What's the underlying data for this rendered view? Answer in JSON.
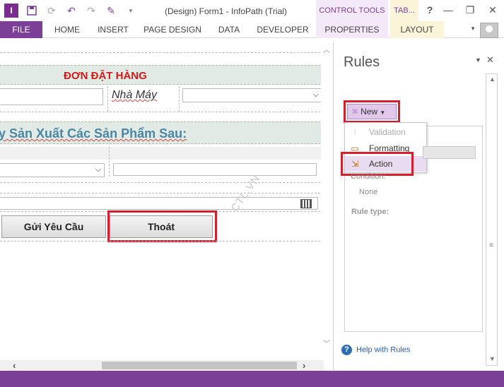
{
  "window": {
    "title": "(Design) Form1 - InfoPath (Trial)",
    "app_logo": "I",
    "contextual_groups": [
      "CONTROL TOOLS",
      "TAB..."
    ],
    "help": "?",
    "minimize": "—",
    "restore": "❐",
    "close": "✕"
  },
  "ribbon": {
    "tabs": [
      "FILE",
      "HOME",
      "INSERT",
      "PAGE DESIGN",
      "DATA",
      "DEVELOPER",
      "PROPERTIES",
      "LAYOUT"
    ]
  },
  "form": {
    "header_title": "ĐƠN ĐẶT HÀNG",
    "factory_label": "Nhà Máy",
    "section_title": "y Sản Xuất Các Sản Phẩm Sau:",
    "submit_button": "Gửi Yêu Cầu",
    "exit_button": "Thoát",
    "watermark": "CTL.VN"
  },
  "rules_pane": {
    "title": "Rules",
    "new_button": "New",
    "menu": [
      {
        "label": "Validation",
        "disabled": true
      },
      {
        "label": "Formatting",
        "disabled": false
      },
      {
        "label": "Action",
        "disabled": false
      }
    ],
    "condition_label": "Condition:",
    "condition_value": "None",
    "rule_type_label": "Rule type:",
    "help_link": "Help with Rules"
  },
  "colors": {
    "accent": "#7b3f98",
    "highlight": "#d2202f",
    "header_red": "#d11a1a",
    "section_blue": "#4a87a4"
  }
}
